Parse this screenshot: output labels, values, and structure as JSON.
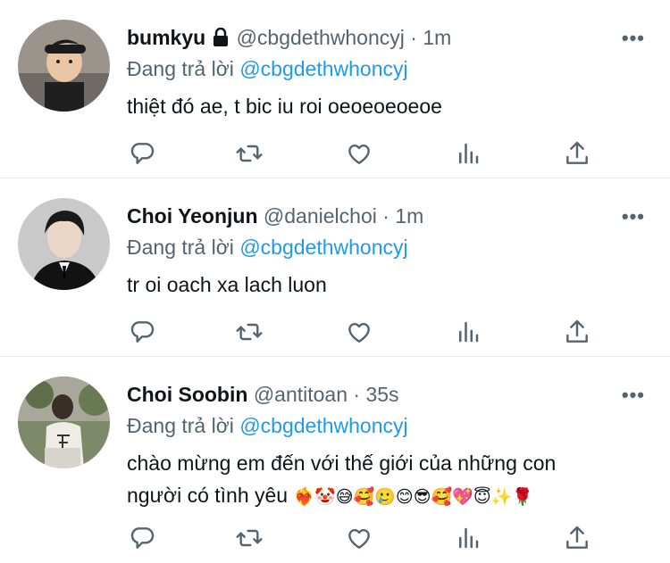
{
  "replying_prefix": "Đang trả lời",
  "tweets": [
    {
      "name": "bumkyu",
      "handle": "@cbgdethwhoncyj",
      "time": "1m",
      "replying_to": "@cbgdethwhoncyj",
      "text": "thiệt đó ae, t bic iu roi oeoeoeoeoe",
      "locked": true,
      "avatar": "photo of a small child in a black cap"
    },
    {
      "name": "Choi Yeonjun",
      "handle": "@danielchoi",
      "time": "1m",
      "replying_to": "@cbgdethwhoncyj",
      "text": "tr oi oach xa lach luon",
      "locked": false,
      "avatar": "photo of a young man in a black suit"
    },
    {
      "name": "Choi Soobin",
      "handle": "@antitoan",
      "time": "35s",
      "replying_to": "@cbgdethwhoncyj",
      "text_line1": "chào mừng em đến với thế giới của những con",
      "text_line2": "người có tình yêu",
      "emojis": "❤️‍🔥🤡😅🥰🥲😊😎🥰💖😇✨🌹",
      "locked": false,
      "avatar": "photo of a person in a white t-shirt outdoors"
    }
  ],
  "more_label": "•••",
  "icons": [
    "reply-icon",
    "retweet-icon",
    "like-icon",
    "analytics-icon",
    "share-icon"
  ],
  "colors": {
    "link": "#1d9bf0",
    "muted": "#536471",
    "text": "#0f1419",
    "divider": "#e6ecf0"
  }
}
